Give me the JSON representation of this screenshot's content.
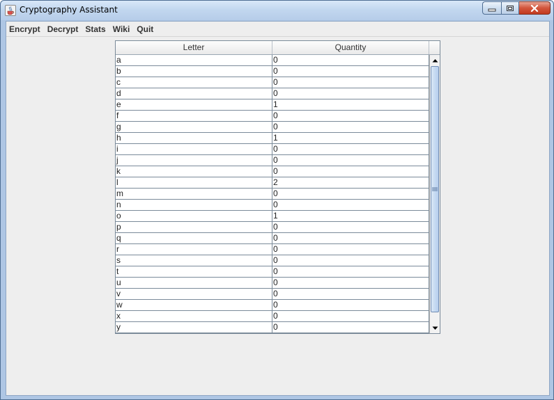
{
  "window": {
    "title": "Cryptography Assistant",
    "icon": "java-cup-icon"
  },
  "menu": {
    "items": [
      "Encrypt",
      "Decrypt",
      "Stats",
      "Wiki",
      "Quit"
    ]
  },
  "table": {
    "headers": [
      "Letter",
      "Quantity"
    ],
    "rows": [
      [
        "a",
        "0"
      ],
      [
        "b",
        "0"
      ],
      [
        "c",
        "0"
      ],
      [
        "d",
        "0"
      ],
      [
        "e",
        "1"
      ],
      [
        "f",
        "0"
      ],
      [
        "g",
        "0"
      ],
      [
        "h",
        "1"
      ],
      [
        "i",
        "0"
      ],
      [
        "j",
        "0"
      ],
      [
        "k",
        "0"
      ],
      [
        "l",
        "2"
      ],
      [
        "m",
        "0"
      ],
      [
        "n",
        "0"
      ],
      [
        "o",
        "1"
      ],
      [
        "p",
        "0"
      ],
      [
        "q",
        "0"
      ],
      [
        "r",
        "0"
      ],
      [
        "s",
        "0"
      ],
      [
        "t",
        "0"
      ],
      [
        "u",
        "0"
      ],
      [
        "v",
        "0"
      ],
      [
        "w",
        "0"
      ],
      [
        "x",
        "0"
      ],
      [
        "y",
        "0"
      ]
    ]
  },
  "colors": {
    "accent": "#6f8bb3",
    "close_button": "#c23a1f"
  }
}
